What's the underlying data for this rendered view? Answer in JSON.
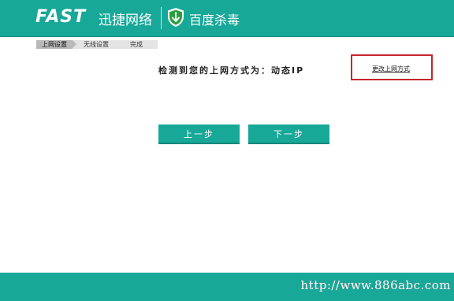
{
  "header": {
    "logo": "FAST",
    "brand": "迅捷网络",
    "antivirus": "百度杀毒",
    "shield_icon": "shield-check-icon"
  },
  "steps": {
    "items": [
      {
        "label": "上网设置",
        "active": true
      },
      {
        "label": "无线设置",
        "active": false
      },
      {
        "label": "完成",
        "active": false
      }
    ]
  },
  "main": {
    "detect_text": "检测到您的上网方式为：动态IP",
    "change_link": "更改上网方式",
    "prev_button": "上一步",
    "next_button": "下一步"
  },
  "footer": {
    "watermark": "http://www.886abc.com"
  },
  "colors": {
    "primary": "#17a898",
    "highlight_border": "#c8252c"
  }
}
